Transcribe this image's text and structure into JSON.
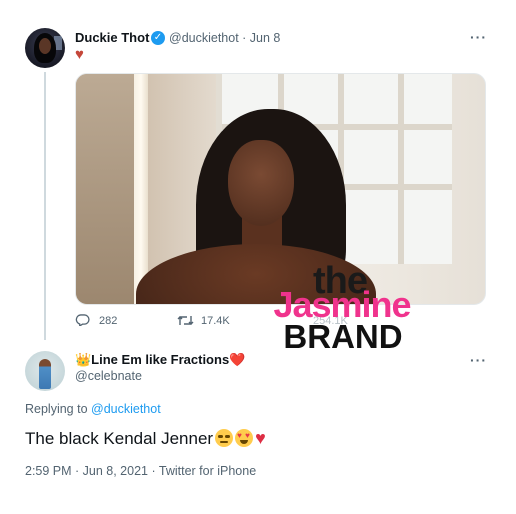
{
  "tweet": {
    "author_name": "Duckie Thot",
    "handle_date": "@duckiethot · Jun 8",
    "verified_mark": "✓",
    "body_emoji": "♥",
    "more": "···",
    "reply_count": "282",
    "retweet_count": "17.4K",
    "like_count": "254.1K"
  },
  "watermark": {
    "line1": "the",
    "line2": "Jasmine",
    "line3": "BRAND"
  },
  "reply": {
    "author_name": "👑Line Em like Fractions❤️",
    "handle": "@celebnate",
    "more": "···",
    "replying_prefix": "Replying to ",
    "replying_to": "@duckiethot",
    "text": "The black Kendal Jenner",
    "timestamp": "2:59 PM · Jun 8, 2021 · Twitter for iPhone"
  },
  "icons": {
    "reply": "reply-icon",
    "retweet": "retweet-icon",
    "verified": "verified-badge-icon"
  },
  "colors": {
    "accent": "#1d9bf0",
    "muted": "#536471",
    "watermark_pink": "#f0338d",
    "heart": "#dd2e44"
  }
}
